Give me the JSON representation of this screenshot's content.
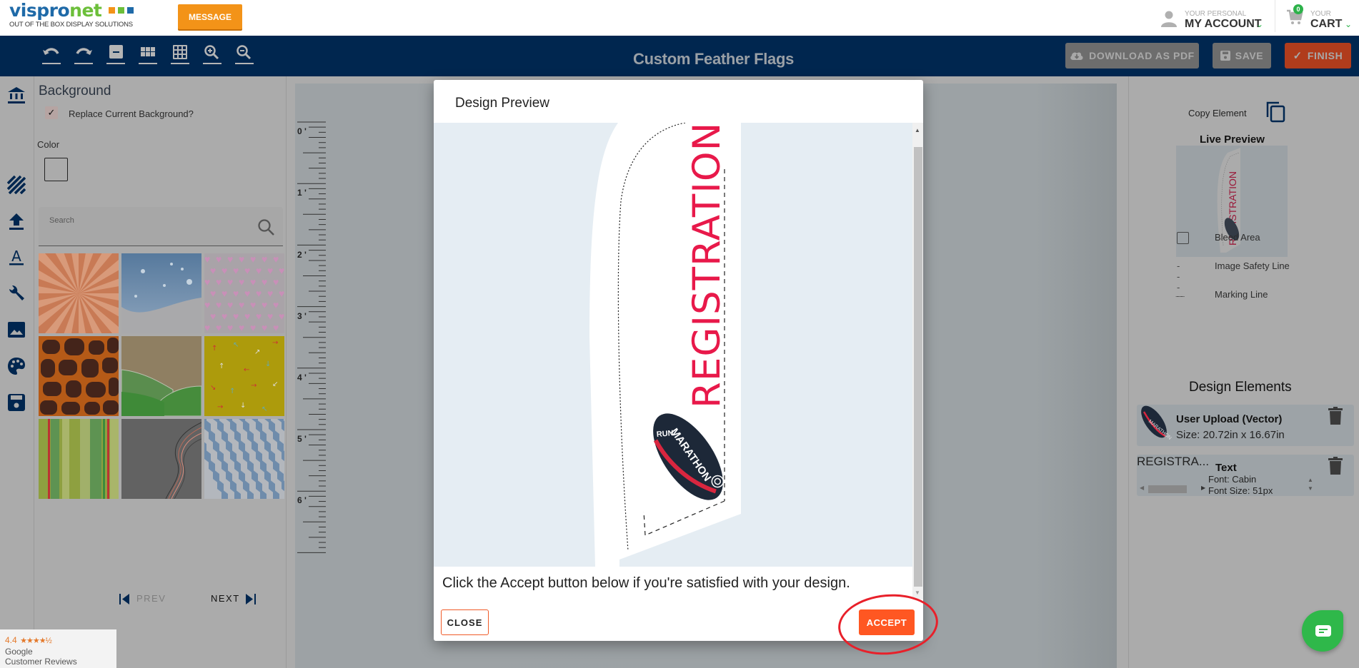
{
  "header": {
    "logo": {
      "word_part1": "vispro",
      "word_part2": "net",
      "tagline": "OUT OF THE BOX DISPLAY SOLUTIONS",
      "squares": [
        "#f39318",
        "#6cbf3a",
        "#1f6aa8"
      ]
    },
    "message_button": "MESSAGE",
    "account": {
      "small": "YOUR PERSONAL",
      "big": "MY ACCOUNT"
    },
    "cart": {
      "count": "0",
      "small": "YOUR",
      "big": "CART"
    }
  },
  "toolbar": {
    "icons": [
      "undo-icon",
      "redo-icon",
      "single-panel-icon",
      "grid-6-icon",
      "grid-9-icon",
      "zoom-in-icon",
      "zoom-out-icon"
    ],
    "title": "Custom Feather Flags",
    "download_pdf": "DOWNLOAD AS PDF",
    "save": "SAVE",
    "finish": "FINISH"
  },
  "rail": {
    "icons": [
      "templates-icon",
      "pattern-icon",
      "upload-icon",
      "text-icon",
      "tools-icon",
      "image-icon",
      "palette-icon",
      "save-icon"
    ]
  },
  "left_panel": {
    "title": "Background",
    "replace_label": "Replace Current Background?",
    "replace_checked": true,
    "color_label": "Color",
    "search_placeholder": "Search",
    "tiles": [
      "sunburst-orange",
      "snow-blue",
      "hearts-pink",
      "giraffe-brown",
      "hills-green",
      "arrows-yellow",
      "stripes-green",
      "waves-gray",
      "diamonds-blue"
    ],
    "prev": "PREV",
    "next": "NEXT"
  },
  "ruler": {
    "labels": [
      "0 '",
      "1 '",
      "2 '",
      "3 '",
      "4 '",
      "5 '",
      "6 '"
    ]
  },
  "right_panel": {
    "copy_element": "Copy Element",
    "live_preview": "Live Preview",
    "live_preview_text": "REGISTRATION",
    "bleed_area": "Bleed Area",
    "image_safety_line_symbol": "- - -",
    "image_safety_line": "Image Safety Line",
    "marking_line_symbol": "..........",
    "marking_line": "Marking Line",
    "design_elements_title": "Design Elements",
    "elements": [
      {
        "name": "User Upload (Vector)",
        "size": "Size: 20.72in x 16.67in"
      },
      {
        "preview": "REGISTRA...",
        "type": "Text",
        "font": "Font: Cabin",
        "font_size": "Font Size: 51px"
      }
    ]
  },
  "modal": {
    "title": "Design Preview",
    "flag_text": "REGISTRATION",
    "logo_text_top": "RUN",
    "logo_text_main": "MARATHON",
    "message": "Click the Accept button below if you're satisfied with your design.",
    "close": "CLOSE",
    "accept": "ACCEPT",
    "accent": "#ff5722",
    "flag_text_color": "#e8194a"
  },
  "reviews": {
    "rating": "4.4",
    "stars": "★★★★½",
    "line1": "Google",
    "line2": "Customer Reviews"
  }
}
